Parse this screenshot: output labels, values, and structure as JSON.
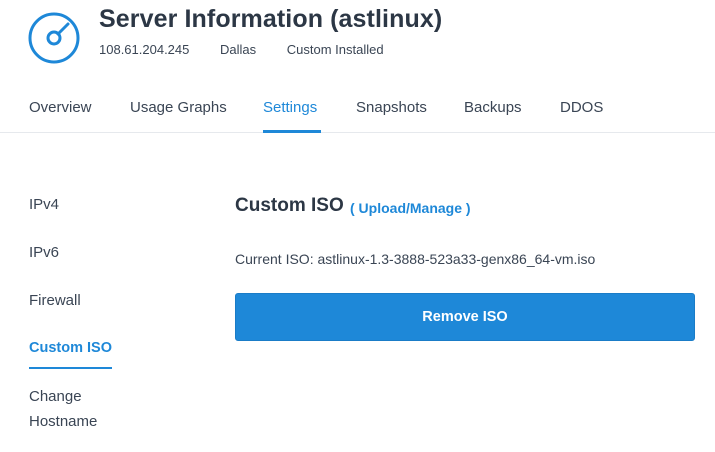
{
  "header": {
    "icon": "disc-icon",
    "title": "Server Information (astlinux)",
    "ip": "108.61.204.245",
    "location": "Dallas",
    "os": "Custom Installed"
  },
  "tabs": [
    {
      "label": "Overview"
    },
    {
      "label": "Usage Graphs"
    },
    {
      "label": "Settings",
      "active": true
    },
    {
      "label": "Snapshots"
    },
    {
      "label": "Backups"
    },
    {
      "label": "DDOS"
    }
  ],
  "sidebar": {
    "items": [
      {
        "label": "IPv4"
      },
      {
        "label": "IPv6"
      },
      {
        "label": "Firewall"
      },
      {
        "label": "Custom ISO",
        "active": true
      },
      {
        "label": "Change"
      },
      {
        "label": "Hostname"
      }
    ]
  },
  "main": {
    "title": "Custom ISO",
    "link_label": "( Upload/Manage )",
    "current_iso": "Current ISO: astlinux-1.3-3888-523a33-genx86_64-vm.iso",
    "remove_button": "Remove ISO"
  },
  "colors": {
    "accent": "#1e88d8",
    "text": "#2c3745"
  }
}
